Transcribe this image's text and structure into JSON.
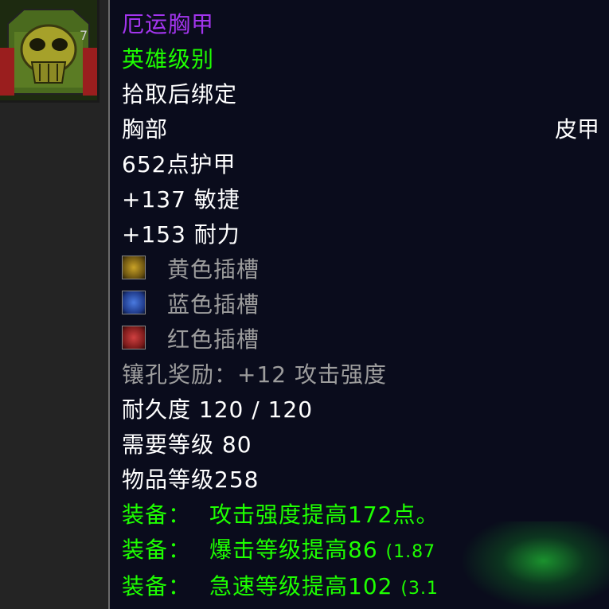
{
  "item": {
    "name": "厄运胸甲",
    "quality": "英雄级别",
    "binding": "拾取后绑定",
    "slot": "胸部",
    "armor_type": "皮甲",
    "armor": "652点护甲",
    "stats": [
      "+137 敏捷",
      "+153 耐力"
    ],
    "sockets": [
      {
        "label": "黄色插槽",
        "color": "#c9a227",
        "icon": "yellow-socket-icon"
      },
      {
        "label": "蓝色插槽",
        "color": "#2f5fd0",
        "icon": "blue-socket-icon"
      },
      {
        "label": "红色插槽",
        "color": "#c0302c",
        "icon": "red-socket-icon"
      }
    ],
    "socket_bonus": "镶孔奖励：+12 攻击强度",
    "durability": "耐久度 120 / 120",
    "required_level": "需要等级 80",
    "item_level": "物品等级258",
    "equip_effects": [
      {
        "prefix": "装备：",
        "text": "攻击强度提高172点。",
        "extra": ""
      },
      {
        "prefix": "装备：",
        "text": "爆击等级提高86",
        "extra": "(1.87"
      },
      {
        "prefix": "装备：",
        "text": "急速等级提高102",
        "extra": "(3.1"
      }
    ]
  },
  "colors": {
    "name": "#a335ee",
    "green": "#1eff00",
    "white": "#ffffff",
    "gray": "#9d9d9d",
    "background": "#0a0c1c"
  }
}
